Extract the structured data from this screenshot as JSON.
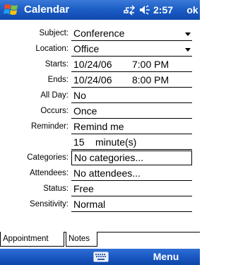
{
  "titlebar": {
    "title": "Calendar",
    "time": "2:57",
    "ok_label": "ok",
    "icons": [
      "windows-start-icon",
      "connectivity-icon",
      "volume-icon"
    ]
  },
  "form": {
    "subject": {
      "label": "Subject:",
      "value": "Conference"
    },
    "location": {
      "label": "Location:",
      "value": "Office"
    },
    "starts": {
      "label": "Starts:",
      "date": "10/24/06",
      "time": "7:00 PM"
    },
    "ends": {
      "label": "Ends:",
      "date": "10/24/06",
      "time": "8:00 PM"
    },
    "all_day": {
      "label": "All Day:",
      "value": "No"
    },
    "occurs": {
      "label": "Occurs:",
      "value": "Once"
    },
    "reminder": {
      "label": "Reminder:",
      "value": "Remind me",
      "amount": "15",
      "unit": "minute(s)"
    },
    "categories": {
      "label": "Categories:",
      "value": "No categories..."
    },
    "attendees": {
      "label": "Attendees:",
      "value": "No attendees..."
    },
    "status": {
      "label": "Status:",
      "value": "Free"
    },
    "sensitivity": {
      "label": "Sensitivity:",
      "value": "Normal"
    }
  },
  "tabs": [
    {
      "label": "Appointment",
      "active": true
    },
    {
      "label": "Notes",
      "active": false
    }
  ],
  "menubar": {
    "menu_label": "Menu",
    "icons": [
      "keyboard-icon"
    ]
  },
  "colors": {
    "titlebar": "#1d5fc7",
    "menubar": "#1a58c2"
  }
}
